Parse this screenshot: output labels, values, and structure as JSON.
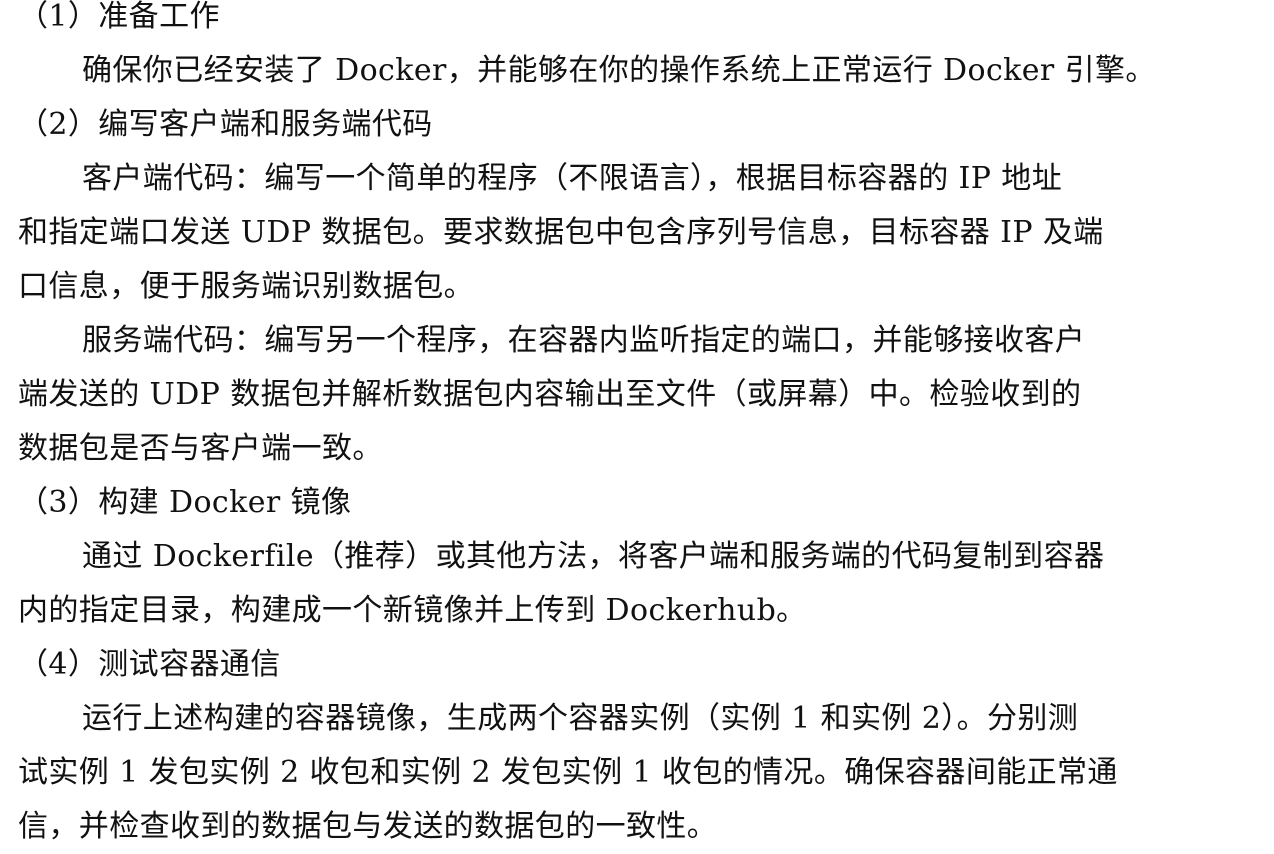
{
  "sections": [
    {
      "heading": "（1）准备工作",
      "paragraphs": [
        [
          "确保你已经安装了 Docker，并能够在你的操作系统上正常运行 Docker 引擎。"
        ]
      ]
    },
    {
      "heading": "（2）编写客户端和服务端代码",
      "paragraphs": [
        [
          "客户端代码：编写一个简单的程序（不限语言），根据目标容器的 IP 地址",
          "和指定端口发送 UDP 数据包。要求数据包中包含序列号信息，目标容器 IP 及端",
          "口信息，便于服务端识别数据包。"
        ],
        [
          "服务端代码：编写另一个程序，在容器内监听指定的端口，并能够接收客户",
          "端发送的 UDP 数据包并解析数据包内容输出至文件（或屏幕）中。检验收到的",
          "数据包是否与客户端一致。"
        ]
      ]
    },
    {
      "heading": "（3）构建 Docker 镜像",
      "paragraphs": [
        [
          "通过 Dockerfile（推荐）或其他方法，将客户端和服务端的代码复制到容器",
          "内的指定目录，构建成一个新镜像并上传到 Dockerhub。"
        ]
      ]
    },
    {
      "heading": "（4）测试容器通信",
      "paragraphs": [
        [
          "运行上述构建的容器镜像，生成两个容器实例（实例 1 和实例 2）。分别测",
          "试实例 1 发包实例 2 收包和实例 2 发包实例 1 收包的情况。确保容器间能正常通",
          "信，并检查收到的数据包与发送的数据包的一致性。"
        ]
      ]
    }
  ]
}
